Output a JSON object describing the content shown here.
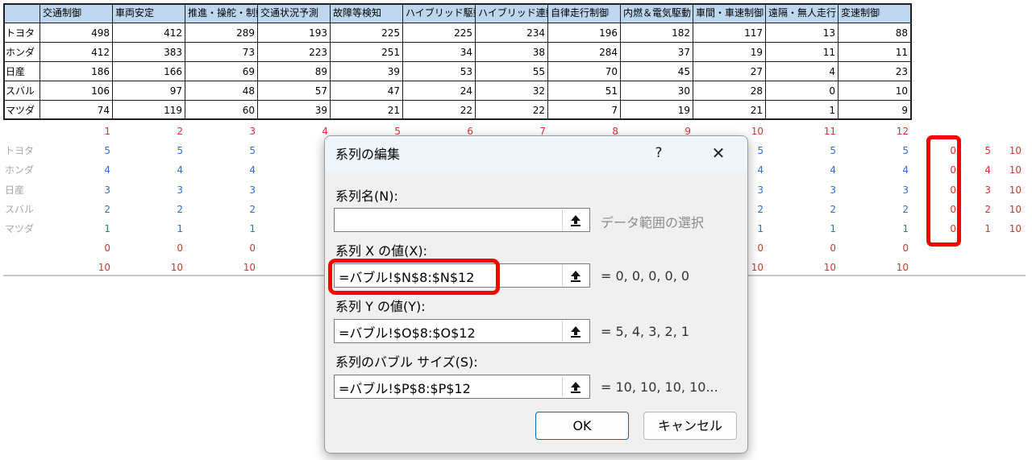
{
  "sheet": {
    "columns": [
      "交通制御",
      "車両安定",
      "推進・操舵・制動",
      "交通状況予測",
      "故障等検知",
      "ハイブリッド駆動",
      "ハイブリッド連動",
      "自律走行制御",
      "内燃＆電気駆動",
      "車間・車速制御",
      "遠隔・無人走行",
      "変速制御"
    ],
    "rows": [
      {
        "label": "トヨタ",
        "values": [
          "498",
          "412",
          "289",
          "193",
          "225",
          "225",
          "234",
          "196",
          "182",
          "117",
          "13",
          "88"
        ]
      },
      {
        "label": "ホンダ",
        "values": [
          "412",
          "383",
          "73",
          "223",
          "251",
          "34",
          "38",
          "284",
          "37",
          "19",
          "11",
          "11"
        ]
      },
      {
        "label": "日産",
        "values": [
          "186",
          "166",
          "69",
          "89",
          "39",
          "53",
          "55",
          "70",
          "45",
          "27",
          "4",
          "23"
        ]
      },
      {
        "label": "スバル",
        "values": [
          "106",
          "97",
          "48",
          "57",
          "47",
          "24",
          "32",
          "51",
          "30",
          "28",
          "0",
          "10"
        ]
      },
      {
        "label": "マツダ",
        "values": [
          "74",
          "119",
          "60",
          "39",
          "21",
          "22",
          "22",
          "7",
          "19",
          "21",
          "1",
          "9"
        ]
      }
    ],
    "index_row": [
      "1",
      "2",
      "3",
      "4",
      "5",
      "6",
      "7",
      "8",
      "9",
      "10",
      "11",
      "12"
    ],
    "grid_labels": [
      "トヨタ",
      "ホンダ",
      "日産",
      "スバル",
      "マツダ"
    ],
    "grid_values_left": [
      "5",
      "4",
      "3",
      "2",
      "1"
    ],
    "grid_values_right": [
      "5",
      "4",
      "3",
      "2",
      "1"
    ],
    "zero_row": "0",
    "ten_row": "10",
    "xyz": {
      "x": [
        "0",
        "0",
        "0",
        "0",
        "0"
      ],
      "y": [
        "5",
        "4",
        "3",
        "2",
        "1"
      ],
      "size": [
        "10",
        "10",
        "10",
        "10",
        "10"
      ]
    }
  },
  "dialog": {
    "title": "系列の編集",
    "help": "?",
    "close": "✕",
    "name_label": "系列名(N):",
    "name_value": "",
    "name_hint": "データ範囲の選択",
    "x_label": "系列 X の値(X):",
    "x_value": "=バブル!$N$8:$N$12",
    "x_result": "= 0, 0, 0, 0, 0",
    "y_label": "系列 Y の値(Y):",
    "y_value": "=バブル!$O$8:$O$12",
    "y_result": "= 5, 4, 3, 2, 1",
    "size_label": "系列のバブル サイズ(S):",
    "size_value": "=バブル!$P$8:$P$12",
    "size_result": "= 10, 10, 10, 10...",
    "ok": "OK",
    "cancel": "キャンセル"
  },
  "colors": {
    "header_bg": "#bdd7ee",
    "red": "#e03030",
    "blue": "#2f6fd0",
    "highlight": "#ff0000"
  },
  "icons": {
    "collapse": "upload-arrow-icon",
    "close": "close-icon",
    "help": "help-icon"
  }
}
